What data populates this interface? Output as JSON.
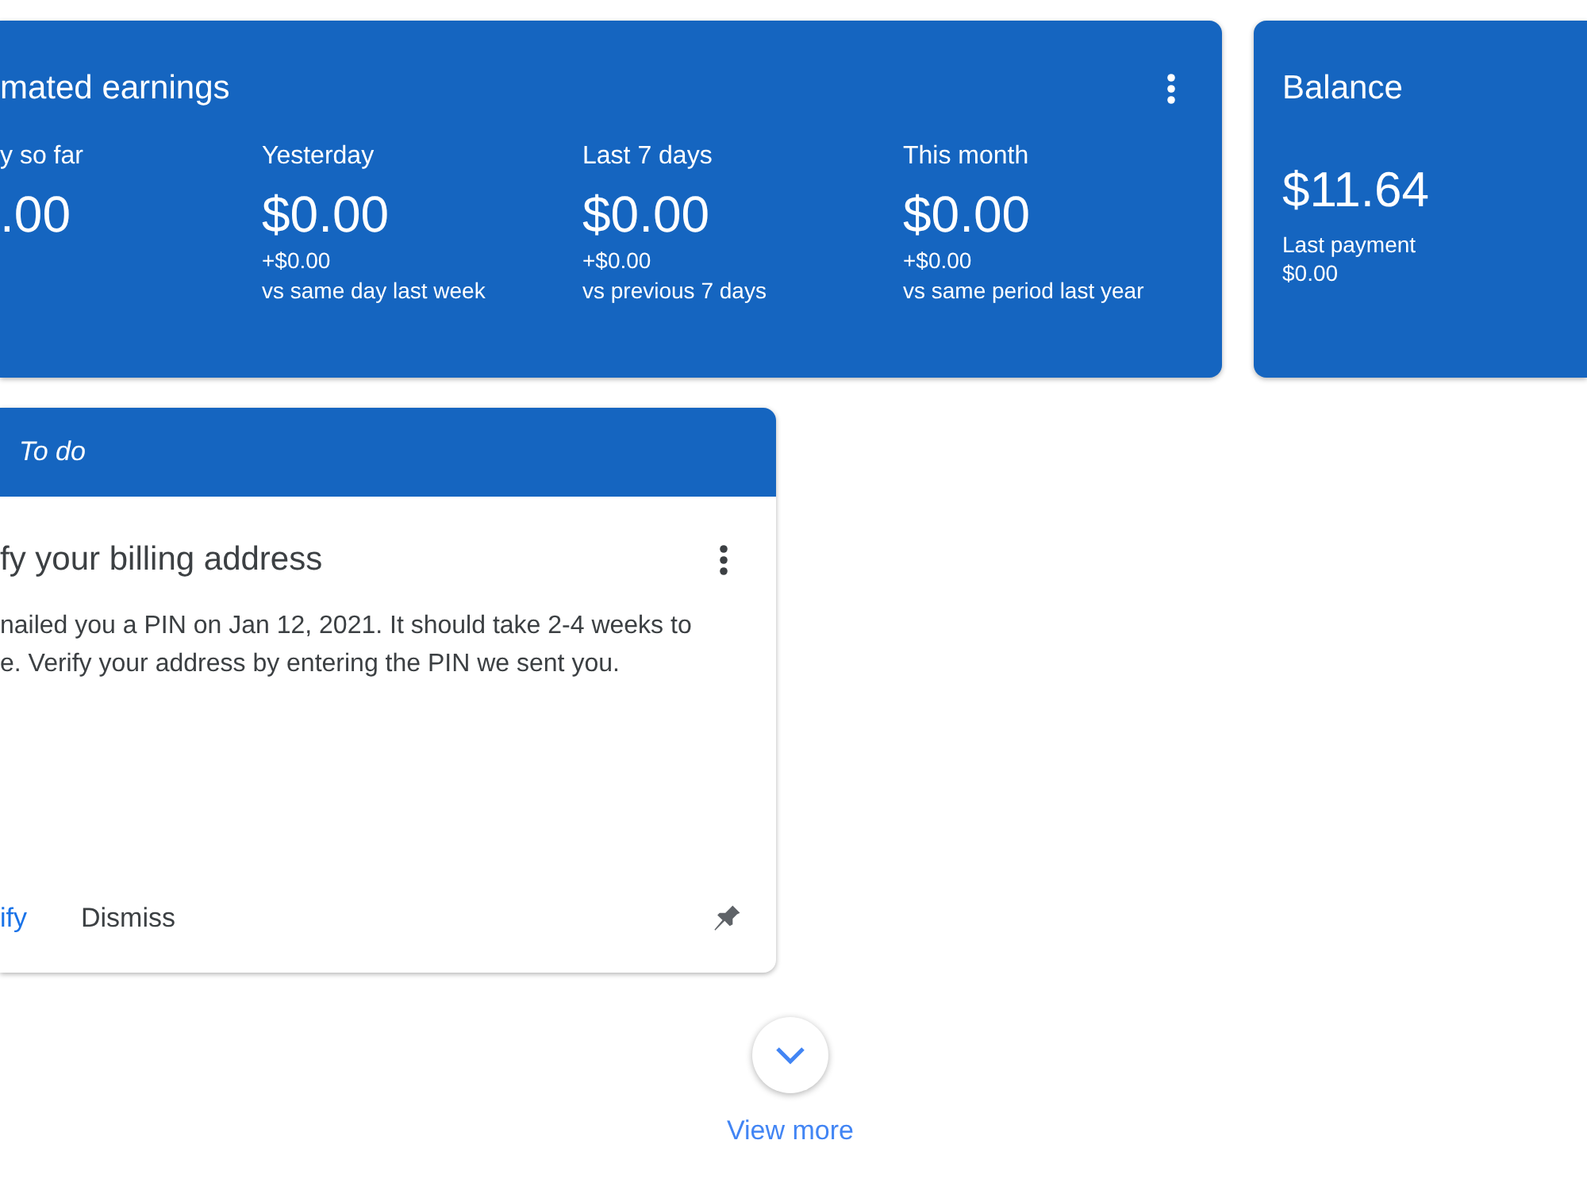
{
  "earnings": {
    "title": "mated earnings",
    "periods": [
      {
        "label": "y so far",
        "amount": ".00"
      },
      {
        "label": "Yesterday",
        "amount": "$0.00",
        "change": "+$0.00",
        "comparison": "vs same day last week"
      },
      {
        "label": "Last 7 days",
        "amount": "$0.00",
        "change": "+$0.00",
        "comparison": "vs previous 7 days"
      },
      {
        "label": "This month",
        "amount": "$0.00",
        "change": "+$0.00",
        "comparison": "vs same period last year"
      }
    ]
  },
  "balance": {
    "title": "Balance",
    "amount": "$11.64",
    "last_payment_label": "Last payment",
    "last_payment": "$0.00"
  },
  "todo": {
    "header": "To do",
    "title": "fy your billing address",
    "body": "nailed you a PIN on Jan 12, 2021. It should take 2-4 weeks to\ne. Verify your address by entering the PIN we sent you.",
    "actions": [
      {
        "label": "ify",
        "kind": "primary"
      },
      {
        "label": "Dismiss",
        "kind": "plain"
      }
    ]
  },
  "view_more": {
    "label": "View more"
  }
}
